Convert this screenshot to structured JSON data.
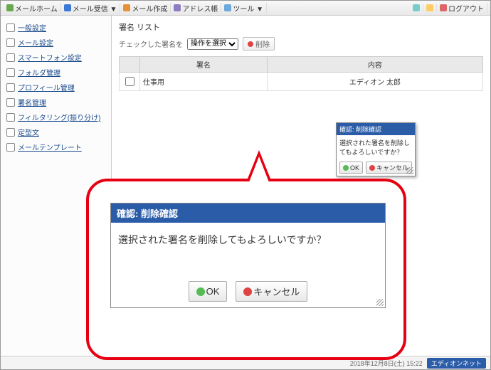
{
  "topbar": {
    "items": [
      {
        "label": "メールホーム",
        "icon": "#6aa84f"
      },
      {
        "label": "メール受信 ▼",
        "icon": "#3c78d8"
      },
      {
        "label": "メール作成",
        "icon": "#e69138"
      },
      {
        "label": "アドレス帳",
        "icon": "#8e7cc3"
      },
      {
        "label": "ツール ▼",
        "icon": "#6fa8dc"
      }
    ],
    "help": "?",
    "info": "i",
    "logout": "ログアウト"
  },
  "sidebar": {
    "items": [
      {
        "label": "一般設定"
      },
      {
        "label": "メール設定"
      },
      {
        "label": "スマートフォン設定"
      },
      {
        "label": "フォルダ管理"
      },
      {
        "label": "プロフィール管理"
      },
      {
        "label": "署名管理"
      },
      {
        "label": "フィルタリング(振り分け)"
      },
      {
        "label": "定型文"
      },
      {
        "label": "メールテンプレート"
      }
    ]
  },
  "main": {
    "title": "署名 リスト",
    "filter_label": "チェックした署名を",
    "filter_select": "操作を選択",
    "delete_button": "削除",
    "columns": {
      "name": "署名",
      "content": "内容"
    },
    "rows": [
      {
        "name": "仕事用",
        "content": "エディオン 太郎"
      }
    ]
  },
  "dialog": {
    "title": "確認: 削除確認",
    "message": "選択された署名を削除してもよろしいですか？",
    "ok": "OK",
    "cancel": "キャンセル"
  },
  "footer": {
    "timestamp": "2018年12月8日(土) 15:22",
    "brand": "エディオンネット"
  }
}
